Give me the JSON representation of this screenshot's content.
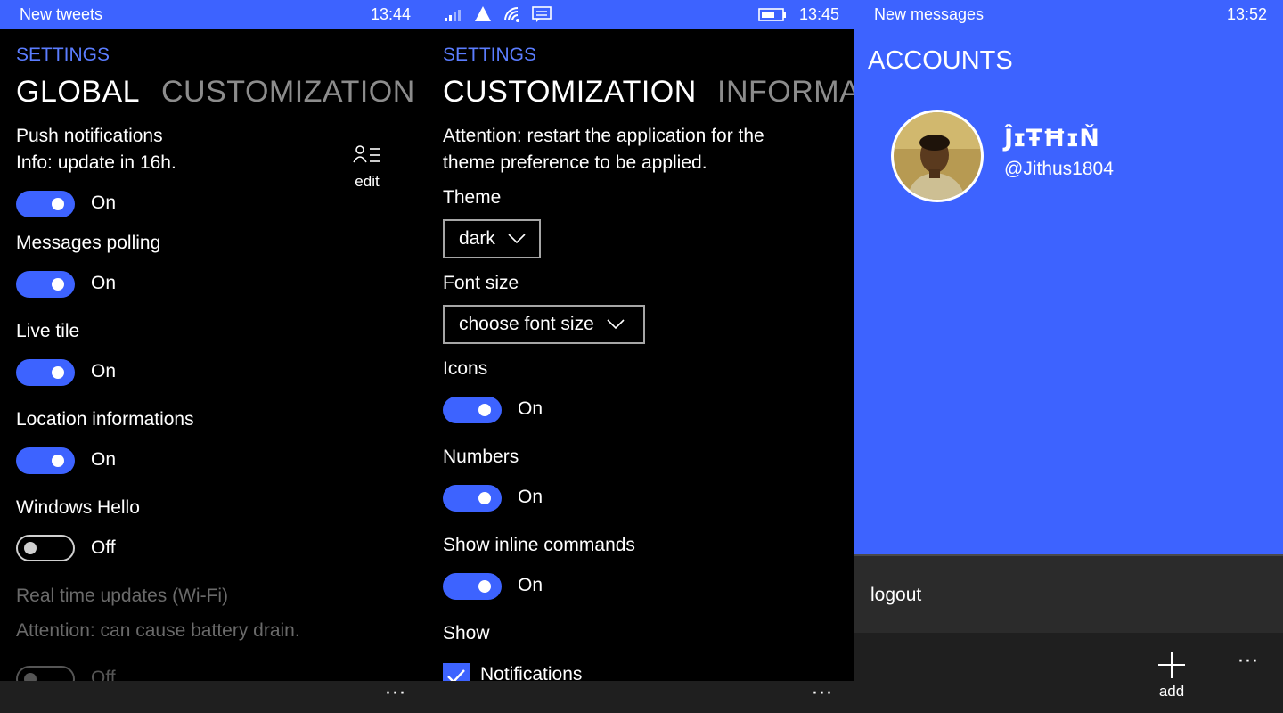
{
  "colors": {
    "accent": "#3d63ff",
    "background": "#000000",
    "appbar": "#1f1f1f"
  },
  "panel1": {
    "status": {
      "left": "New tweets",
      "time": "13:44"
    },
    "pivot_title": "SETTINGS",
    "headers": [
      "GLOBAL",
      "CUSTOMIZATION"
    ],
    "push_label": "Push notifications",
    "push_info": "Info: update in 16h.",
    "edit_label": "edit",
    "settings": [
      {
        "label": "Messages polling",
        "state": "On"
      },
      {
        "label": "Live tile",
        "state": "On"
      },
      {
        "label": "Location informations",
        "state": "On"
      },
      {
        "label": "Windows Hello",
        "state": "Off"
      }
    ],
    "push_state": "On",
    "realtime_label": "Real time updates (Wi-Fi)",
    "realtime_note": "Attention: can cause battery drain.",
    "realtime_state": "Off",
    "more": "···"
  },
  "panel2": {
    "status": {
      "time": "13:45"
    },
    "pivot_title": "SETTINGS",
    "headers": [
      "CUSTOMIZATION",
      "INFORMA"
    ],
    "attention_line1": "Attention: restart the application for the",
    "attention_line2": "theme preference to be applied.",
    "theme_label": "Theme",
    "theme_value": "dark",
    "font_label": "Font size",
    "font_value": "choose font size",
    "icons_label": "Icons",
    "icons_state": "On",
    "numbers_label": "Numbers",
    "numbers_state": "On",
    "inline_label": "Show inline commands",
    "inline_state": "On",
    "show_label": "Show",
    "notifications_label": "Notifications",
    "more": "···"
  },
  "panel3": {
    "status": {
      "left": "New messages",
      "time": "13:52"
    },
    "title": "ACCOUNTS",
    "account_name": "ĴɪŦĦɪŇ",
    "account_handle": "@Jithus1804",
    "logout": "logout",
    "add": "add",
    "more": "···"
  }
}
